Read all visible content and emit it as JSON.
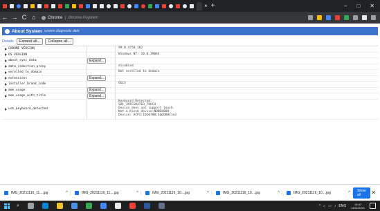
{
  "tabs": {
    "icons": [
      {
        "name": "gmail-icon",
        "color": "#ea4335",
        "shape": "square"
      },
      {
        "name": "chrome-tab-icon",
        "color": "#e8eaed",
        "shape": "square"
      },
      {
        "name": "google-icon",
        "color": "#4285f4",
        "shape": "round"
      },
      {
        "name": "tab-favicon",
        "color": "#e8eaed",
        "shape": "square"
      },
      {
        "name": "drive-icon",
        "color": "#fbbc04",
        "shape": "square"
      },
      {
        "name": "tab-favicon",
        "color": "#e8eaed",
        "shape": "square"
      },
      {
        "name": "tab-favicon",
        "color": "#ea4335",
        "shape": "square"
      },
      {
        "name": "tab-favicon",
        "color": "#e8eaed",
        "shape": "square"
      },
      {
        "name": "youtube-icon",
        "color": "#ea4335",
        "shape": "square"
      },
      {
        "name": "tab-favicon",
        "color": "#34a853",
        "shape": "square"
      },
      {
        "name": "tab-favicon",
        "color": "#fbbc04",
        "shape": "square"
      },
      {
        "name": "tab-favicon",
        "color": "#ea4335",
        "shape": "square"
      },
      {
        "name": "tab-favicon",
        "color": "#4285f4",
        "shape": "square"
      },
      {
        "name": "tab-favicon",
        "color": "#e8eaed",
        "shape": "square"
      },
      {
        "name": "tab-favicon",
        "color": "#e8eaed",
        "shape": "square"
      },
      {
        "name": "tab-favicon",
        "color": "#e8eaed",
        "shape": "round"
      },
      {
        "name": "tab-favicon",
        "color": "#e8eaed",
        "shape": "square"
      },
      {
        "name": "tab-favicon",
        "color": "#ea4335",
        "shape": "square"
      },
      {
        "name": "tab-favicon",
        "color": "#e8eaed",
        "shape": "round"
      },
      {
        "name": "tab-favicon",
        "color": "#4285f4",
        "shape": "square"
      },
      {
        "name": "tab-favicon",
        "color": "#ea4335",
        "shape": "round"
      },
      {
        "name": "tab-favicon",
        "color": "#34a853",
        "shape": "square"
      },
      {
        "name": "tab-favicon",
        "color": "#4285f4",
        "shape": "square"
      },
      {
        "name": "tab-favicon",
        "color": "#ea4335",
        "shape": "square"
      },
      {
        "name": "tab-favicon",
        "color": "#e8eaed",
        "shape": "round"
      },
      {
        "name": "tab-favicon",
        "color": "#ea4335",
        "shape": "square"
      },
      {
        "name": "tab-favicon",
        "color": "#e8eaed",
        "shape": "round"
      },
      {
        "name": "tab-favicon",
        "color": "#e8eaed",
        "shape": "square"
      }
    ],
    "close_glyph": "×",
    "new_tab_glyph": "+",
    "window_controls": {
      "minimize": "–",
      "maximize": "□",
      "close": "✕"
    }
  },
  "toolbar": {
    "back": "←",
    "forward": "→",
    "reload": "C",
    "home": "⌂",
    "omnibox_label": "Chrome",
    "omnibox_sep": "|",
    "omnibox_url": "chrome://system"
  },
  "page": {
    "title": "About System",
    "subtitle": "system diagnostic data",
    "details_label": "Details",
    "expand_all": "Expand all...",
    "collapse_all": "Collapse all...",
    "rows": [
      {
        "key": "CHROME VERSION",
        "has_expand": false,
        "value": "99.0.4758.102"
      },
      {
        "key": "OS VERSION",
        "has_expand": false,
        "value": "Windows NT: 10.0.19044"
      },
      {
        "key": "about_sync_data",
        "has_expand": true,
        "value": ""
      },
      {
        "key": "data_reduction_proxy",
        "has_expand": false,
        "value": "disabled"
      },
      {
        "key": "enrolled_to_domain",
        "has_expand": false,
        "value": "Not enrolled to domain"
      },
      {
        "key": "extensions",
        "has_expand": true,
        "value": ""
      },
      {
        "key": "installer_brand_code",
        "has_expand": false,
        "value": "GGLS"
      },
      {
        "key": "mem_usage",
        "has_expand": true,
        "value": ""
      },
      {
        "key": "mem_usage_with_title",
        "has_expand": true,
        "value": ""
      },
      {
        "key": "usb_keyboard_detected",
        "has_expand": false,
        "value": "Keyboard Detected:\nSDL_INTEGRATED_TOUCH\nDevice does not support touch.\nNot a Kiosk device:NONE0000\nDevice: ACPI:IDE0700:4&EDB0C1e3"
      }
    ],
    "expand_label": "Expand..."
  },
  "downloads": {
    "items": [
      {
        "name": "IMG_20211116_11....jpg"
      },
      {
        "name": "IMG_20211116_11....jpg"
      },
      {
        "name": "IMG_20211116_10....jpg"
      },
      {
        "name": "IMG_20211116_10....jpg"
      },
      {
        "name": "IMG_20211116_10....jpg"
      }
    ],
    "chevron": "^",
    "show_all": "Show all",
    "close": "✕"
  },
  "taskbar": {
    "search_glyph": "⌕",
    "apps": [
      {
        "name": "task-view-icon",
        "color": "#9aa0a6"
      },
      {
        "name": "edge-icon",
        "color": "#0a84d6"
      },
      {
        "name": "file-explorer-icon",
        "color": "#f2c12e"
      },
      {
        "name": "store-icon",
        "color": "#4a8fe7"
      },
      {
        "name": "chrome-app-icon",
        "color": "#34a853"
      },
      {
        "name": "chrome-app-icon",
        "color": "#4285f4"
      },
      {
        "name": "app-icon",
        "color": "#e8eaed"
      },
      {
        "name": "photos-icon",
        "color": "#ea4335"
      },
      {
        "name": "word-icon",
        "color": "#2b579a"
      },
      {
        "name": "photos-app-icon",
        "color": "#5f6f87"
      }
    ],
    "tray_glyphs": [
      "^",
      "⌂",
      "▭",
      "♪",
      "ENG"
    ],
    "time": "16:47",
    "date": "16/11/2021"
  }
}
